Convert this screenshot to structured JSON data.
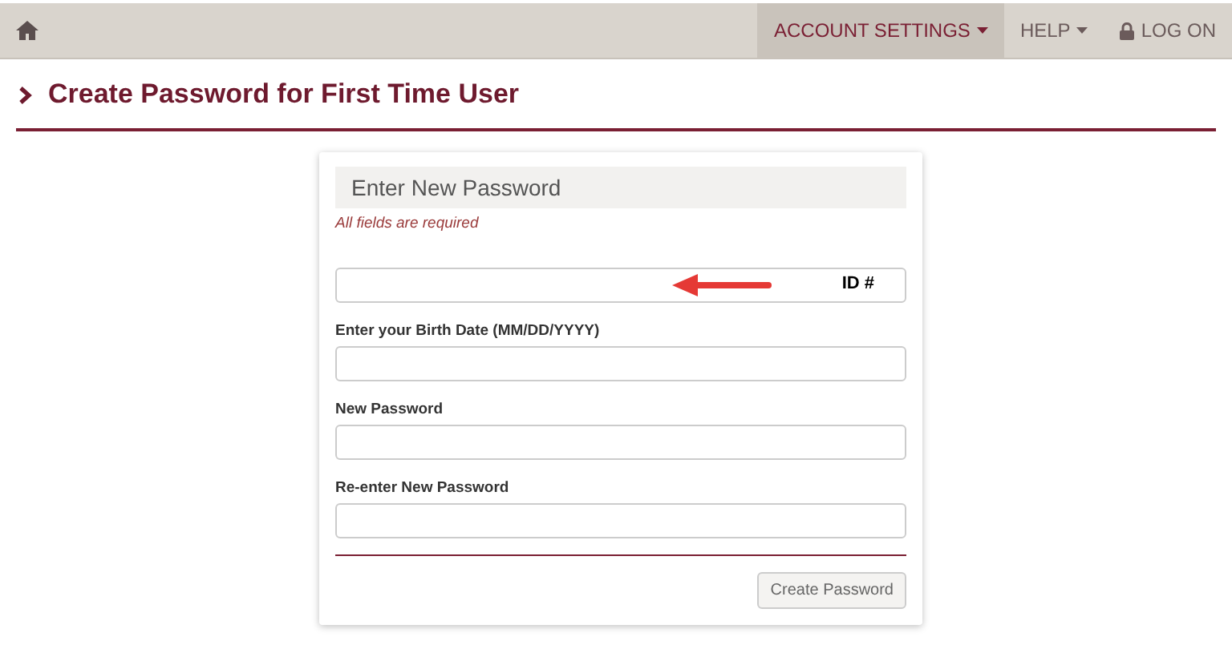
{
  "navbar": {
    "items": [
      {
        "label": "ACCOUNT SETTINGS",
        "kind": "dropdown",
        "selected": true
      },
      {
        "label": "HELP",
        "kind": "dropdown",
        "selected": false
      },
      {
        "label": "LOG ON",
        "kind": "login",
        "selected": false
      }
    ]
  },
  "page_title": "Create Password for First Time User",
  "form": {
    "heading": "Enter New Password",
    "note": "All fields are required",
    "fields": [
      {
        "annotation": "ID #"
      },
      {
        "label": "Enter your Birth Date (MM/DD/YYYY)"
      },
      {
        "label": "New Password"
      },
      {
        "label": "Re-enter New Password"
      }
    ],
    "submit": "Create Password"
  }
}
